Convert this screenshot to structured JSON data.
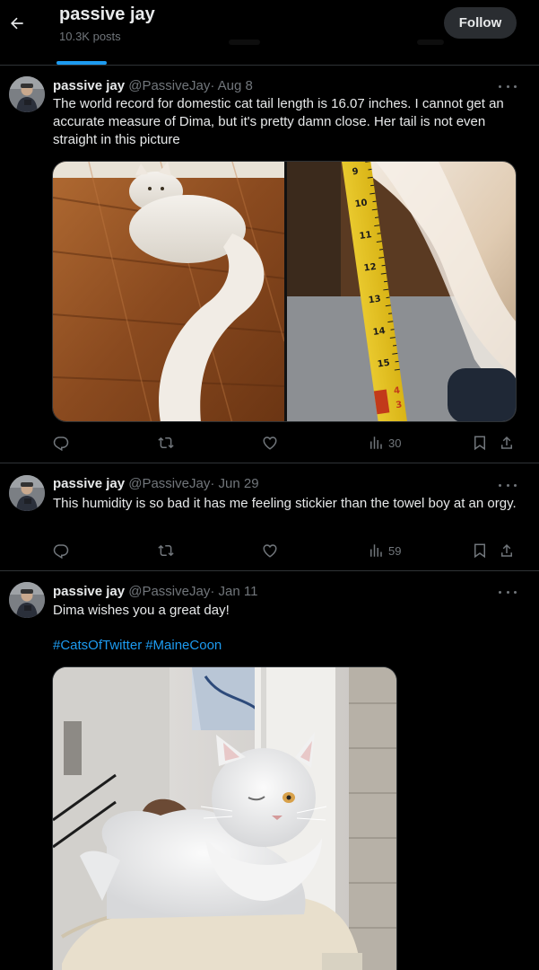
{
  "header": {
    "back_icon": "arrow-left-icon",
    "name": "passive jay",
    "posts_count": "10.3K posts",
    "follow_label": "Follow"
  },
  "posts": [
    {
      "name": "passive jay",
      "handle": "@PassiveJay",
      "separator": "·",
      "date": "Aug 8",
      "text": "The world record for domestic cat tail length is 16.07 inches. I cannot get an accurate measure of Dima, but it's pretty damn close. Her tail is not even straight in this picture",
      "ruler_numbers": [
        "9",
        "10",
        "11",
        "12",
        "13",
        "14",
        "15",
        "4",
        "3"
      ],
      "views": "30"
    },
    {
      "name": "passive jay",
      "handle": "@PassiveJay",
      "separator": "·",
      "date": "Jun 29",
      "text": "This humidity is so bad it has me feeling stickier than the towel boy at an orgy.",
      "views": "59"
    },
    {
      "name": "passive jay",
      "handle": "@PassiveJay",
      "separator": "·",
      "date": "Jan 11",
      "text": "Dima wishes you a great day!",
      "hashtags": [
        "#CatsOfTwitter",
        "#MaineCoon"
      ]
    }
  ],
  "icons": {
    "reply": "reply-icon",
    "repost": "repost-icon",
    "like": "heart-icon",
    "views": "views-icon",
    "bookmark": "bookmark-icon",
    "share": "share-icon",
    "more": "more-icon"
  },
  "colors": {
    "background": "#000000",
    "text": "#e7e9ea",
    "muted": "#71767b",
    "accent": "#1d9bf0",
    "border": "#2f3336",
    "follow_bg": "#2a2d31"
  }
}
